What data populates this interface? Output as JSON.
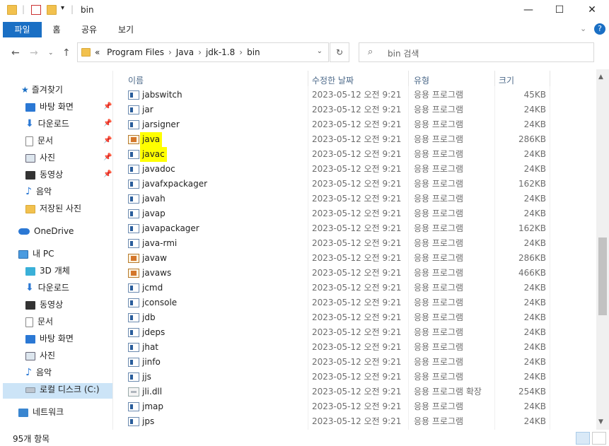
{
  "window": {
    "title": "bin",
    "controls": {
      "minimize": "—",
      "maximize": "☐",
      "close": "✕"
    }
  },
  "ribbon": {
    "tabs": [
      {
        "label": "파일",
        "active": true
      },
      {
        "label": "홈",
        "active": false
      },
      {
        "label": "공유",
        "active": false
      },
      {
        "label": "보기",
        "active": false
      }
    ],
    "collapse_icon": "chevron-down-icon",
    "help_icon": "help-icon"
  },
  "address": {
    "crumbs": [
      "Program Files",
      "Java",
      "jdk-1.8",
      "bin"
    ],
    "prefix": "«",
    "search_placeholder": "bin 검색"
  },
  "sidebar": {
    "quick_access": {
      "label": "즐겨찾기"
    },
    "quick_items": [
      {
        "label": "바탕 화면",
        "icon": "desktop-icon",
        "pinned": true
      },
      {
        "label": "다운로드",
        "icon": "download-icon",
        "pinned": true
      },
      {
        "label": "문서",
        "icon": "document-icon",
        "pinned": true
      },
      {
        "label": "사진",
        "icon": "pictures-icon",
        "pinned": true
      },
      {
        "label": "동영상",
        "icon": "video-icon",
        "pinned": true
      },
      {
        "label": "음악",
        "icon": "music-icon",
        "pinned": false
      },
      {
        "label": "저장된 사진",
        "icon": "folder-icon",
        "pinned": false
      }
    ],
    "onedrive": {
      "label": "OneDrive"
    },
    "this_pc": {
      "label": "내 PC"
    },
    "pc_items": [
      {
        "label": "3D 개체",
        "icon": "3d-objects-icon"
      },
      {
        "label": "다운로드",
        "icon": "download-icon"
      },
      {
        "label": "동영상",
        "icon": "video-icon"
      },
      {
        "label": "문서",
        "icon": "document-icon"
      },
      {
        "label": "바탕 화면",
        "icon": "desktop-icon"
      },
      {
        "label": "사진",
        "icon": "pictures-icon"
      },
      {
        "label": "음악",
        "icon": "music-icon"
      },
      {
        "label": "로컬 디스크 (C:)",
        "icon": "drive-icon",
        "selected": true
      }
    ],
    "network": {
      "label": "네트워크"
    }
  },
  "columns": {
    "name": "이름",
    "date": "수정한 날짜",
    "type": "유형",
    "size": "크기"
  },
  "files": [
    {
      "name": "jabswitch",
      "date": "2023-05-12 오전 9:21",
      "type": "응용 프로그램",
      "size": "45KB",
      "icon": "app-icon"
    },
    {
      "name": "jar",
      "date": "2023-05-12 오전 9:21",
      "type": "응용 프로그램",
      "size": "24KB",
      "icon": "app-icon"
    },
    {
      "name": "jarsigner",
      "date": "2023-05-12 오전 9:21",
      "type": "응용 프로그램",
      "size": "24KB",
      "icon": "app-icon"
    },
    {
      "name": "java",
      "date": "2023-05-12 오전 9:21",
      "type": "응용 프로그램",
      "size": "286KB",
      "icon": "java-icon",
      "highlight": true
    },
    {
      "name": "javac",
      "date": "2023-05-12 오전 9:21",
      "type": "응용 프로그램",
      "size": "24KB",
      "icon": "app-icon",
      "highlight": true
    },
    {
      "name": "javadoc",
      "date": "2023-05-12 오전 9:21",
      "type": "응용 프로그램",
      "size": "24KB",
      "icon": "app-icon"
    },
    {
      "name": "javafxpackager",
      "date": "2023-05-12 오전 9:21",
      "type": "응용 프로그램",
      "size": "162KB",
      "icon": "app-icon"
    },
    {
      "name": "javah",
      "date": "2023-05-12 오전 9:21",
      "type": "응용 프로그램",
      "size": "24KB",
      "icon": "app-icon"
    },
    {
      "name": "javap",
      "date": "2023-05-12 오전 9:21",
      "type": "응용 프로그램",
      "size": "24KB",
      "icon": "app-icon"
    },
    {
      "name": "javapackager",
      "date": "2023-05-12 오전 9:21",
      "type": "응용 프로그램",
      "size": "162KB",
      "icon": "app-icon"
    },
    {
      "name": "java-rmi",
      "date": "2023-05-12 오전 9:21",
      "type": "응용 프로그램",
      "size": "24KB",
      "icon": "app-icon"
    },
    {
      "name": "javaw",
      "date": "2023-05-12 오전 9:21",
      "type": "응용 프로그램",
      "size": "286KB",
      "icon": "java-icon"
    },
    {
      "name": "javaws",
      "date": "2023-05-12 오전 9:21",
      "type": "응용 프로그램",
      "size": "466KB",
      "icon": "java-icon"
    },
    {
      "name": "jcmd",
      "date": "2023-05-12 오전 9:21",
      "type": "응용 프로그램",
      "size": "24KB",
      "icon": "app-icon"
    },
    {
      "name": "jconsole",
      "date": "2023-05-12 오전 9:21",
      "type": "응용 프로그램",
      "size": "24KB",
      "icon": "app-icon"
    },
    {
      "name": "jdb",
      "date": "2023-05-12 오전 9:21",
      "type": "응용 프로그램",
      "size": "24KB",
      "icon": "app-icon"
    },
    {
      "name": "jdeps",
      "date": "2023-05-12 오전 9:21",
      "type": "응용 프로그램",
      "size": "24KB",
      "icon": "app-icon"
    },
    {
      "name": "jhat",
      "date": "2023-05-12 오전 9:21",
      "type": "응용 프로그램",
      "size": "24KB",
      "icon": "app-icon"
    },
    {
      "name": "jinfo",
      "date": "2023-05-12 오전 9:21",
      "type": "응용 프로그램",
      "size": "24KB",
      "icon": "app-icon"
    },
    {
      "name": "jjs",
      "date": "2023-05-12 오전 9:21",
      "type": "응용 프로그램",
      "size": "24KB",
      "icon": "app-icon"
    },
    {
      "name": "jli.dll",
      "date": "2023-05-12 오전 9:21",
      "type": "응용 프로그램 확장",
      "size": "254KB",
      "icon": "dll-icon"
    },
    {
      "name": "jmap",
      "date": "2023-05-12 오전 9:21",
      "type": "응용 프로그램",
      "size": "24KB",
      "icon": "app-icon"
    },
    {
      "name": "jps",
      "date": "2023-05-12 오전 9:21",
      "type": "응용 프로그램",
      "size": "24KB",
      "icon": "app-icon"
    }
  ],
  "status": {
    "item_count": "95개 항목"
  },
  "colors": {
    "accent": "#1a6fc4",
    "highlight": "#ffff00",
    "selection": "#cce4f7"
  }
}
